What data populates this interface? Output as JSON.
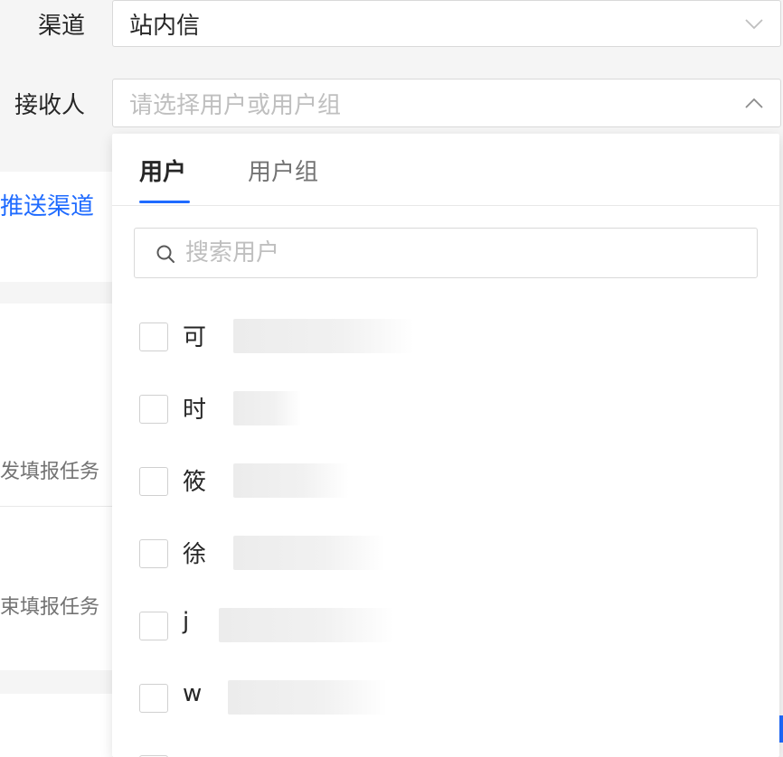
{
  "form": {
    "channel_label": "渠道",
    "channel_value": "站内信",
    "receiver_label": "接收人",
    "receiver_placeholder": "请选择用户或用户组"
  },
  "side": {
    "link": "推送渠道",
    "task_text_1": "发填报任务",
    "task_text_2": "束填报任务"
  },
  "dropdown": {
    "tabs": [
      {
        "label": "用户",
        "active": true
      },
      {
        "label": "用户组",
        "active": false
      }
    ],
    "search_placeholder": "搜索用户",
    "options": [
      {
        "label": "可"
      },
      {
        "label": "时"
      },
      {
        "label": "筱"
      },
      {
        "label": "徐"
      },
      {
        "label": "j"
      },
      {
        "label": "w"
      }
    ]
  },
  "colors": {
    "accent": "#1f6bff",
    "border": "#d9d9d9",
    "placeholder": "#bfbfbf"
  }
}
